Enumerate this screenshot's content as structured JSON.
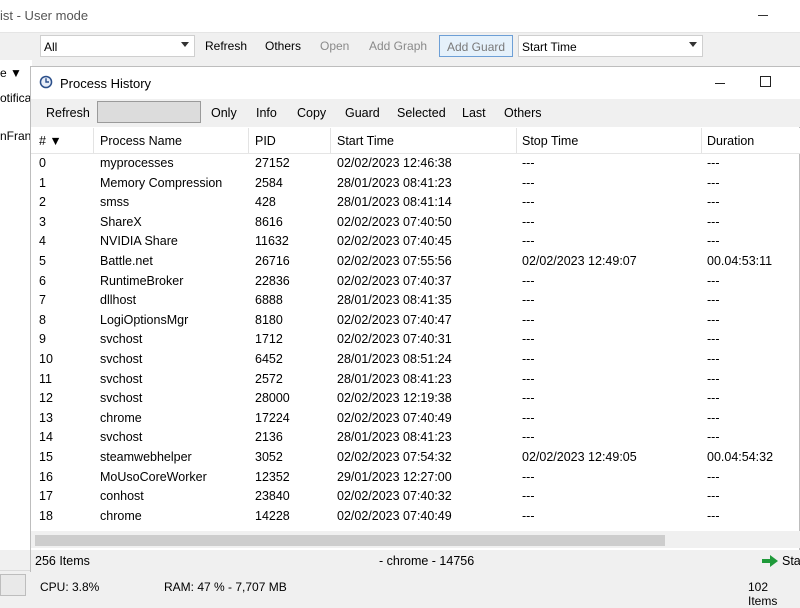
{
  "main_window": {
    "title": "ist - User mode",
    "toolbar": {
      "filter_combo_value": "All",
      "buttons": [
        "Refresh",
        "Others",
        "Open",
        "Add Graph",
        "Add Guard"
      ],
      "sort_combo_value": "Start Time"
    },
    "left_column_fragments": [
      "e ▼",
      "otifica",
      "nFran"
    ],
    "status": {
      "cpu": "CPU: 3.8%",
      "ram": "RAM: 47 % - 7,707 MB",
      "items": "102 Items"
    }
  },
  "process_history": {
    "title": "Process History",
    "toolbar": [
      "Refresh",
      "Only",
      "Info",
      "Copy",
      "Guard",
      "Selected",
      "Last",
      "Others"
    ],
    "columns": [
      "# ▼",
      "Process Name",
      "PID",
      "Start Time",
      "Stop Time",
      "Duration"
    ],
    "rows": [
      [
        "0",
        "myprocesses",
        "27152",
        "02/02/2023 12:46:38",
        "---",
        "---"
      ],
      [
        "1",
        "Memory Compression",
        "2584",
        "28/01/2023 08:41:23",
        "---",
        "---"
      ],
      [
        "2",
        "smss",
        "428",
        "28/01/2023 08:41:14",
        "---",
        "---"
      ],
      [
        "3",
        "ShareX",
        "8616",
        "02/02/2023 07:40:50",
        "---",
        "---"
      ],
      [
        "4",
        "NVIDIA Share",
        "11632",
        "02/02/2023 07:40:45",
        "---",
        "---"
      ],
      [
        "5",
        "Battle.net",
        "26716",
        "02/02/2023 07:55:56",
        "02/02/2023 12:49:07",
        "00.04:53:11"
      ],
      [
        "6",
        "RuntimeBroker",
        "22836",
        "02/02/2023 07:40:37",
        "---",
        "---"
      ],
      [
        "7",
        "dllhost",
        "6888",
        "28/01/2023 08:41:35",
        "---",
        "---"
      ],
      [
        "8",
        "LogiOptionsMgr",
        "8180",
        "02/02/2023 07:40:47",
        "---",
        "---"
      ],
      [
        "9",
        "svchost",
        "1712",
        "02/02/2023 07:40:31",
        "---",
        "---"
      ],
      [
        "10",
        "svchost",
        "6452",
        "28/01/2023 08:51:24",
        "---",
        "---"
      ],
      [
        "11",
        "svchost",
        "2572",
        "28/01/2023 08:41:23",
        "---",
        "---"
      ],
      [
        "12",
        "svchost",
        "28000",
        "02/02/2023 12:19:38",
        "---",
        "---"
      ],
      [
        "13",
        "chrome",
        "17224",
        "02/02/2023 07:40:49",
        "---",
        "---"
      ],
      [
        "14",
        "svchost",
        "2136",
        "28/01/2023 08:41:23",
        "---",
        "---"
      ],
      [
        "15",
        "steamwebhelper",
        "3052",
        "02/02/2023 07:54:32",
        "02/02/2023 12:49:05",
        "00.04:54:32"
      ],
      [
        "16",
        "MoUsoCoreWorker",
        "12352",
        "29/01/2023 12:27:00",
        "---",
        "---"
      ],
      [
        "17",
        "conhost",
        "23840",
        "02/02/2023 07:40:32",
        "---",
        "---"
      ],
      [
        "18",
        "chrome",
        "14228",
        "02/02/2023 07:40:49",
        "---",
        "---"
      ]
    ],
    "status": {
      "item_count": "256 Items",
      "selected": "- chrome - 14756",
      "start_label": "Star"
    }
  }
}
